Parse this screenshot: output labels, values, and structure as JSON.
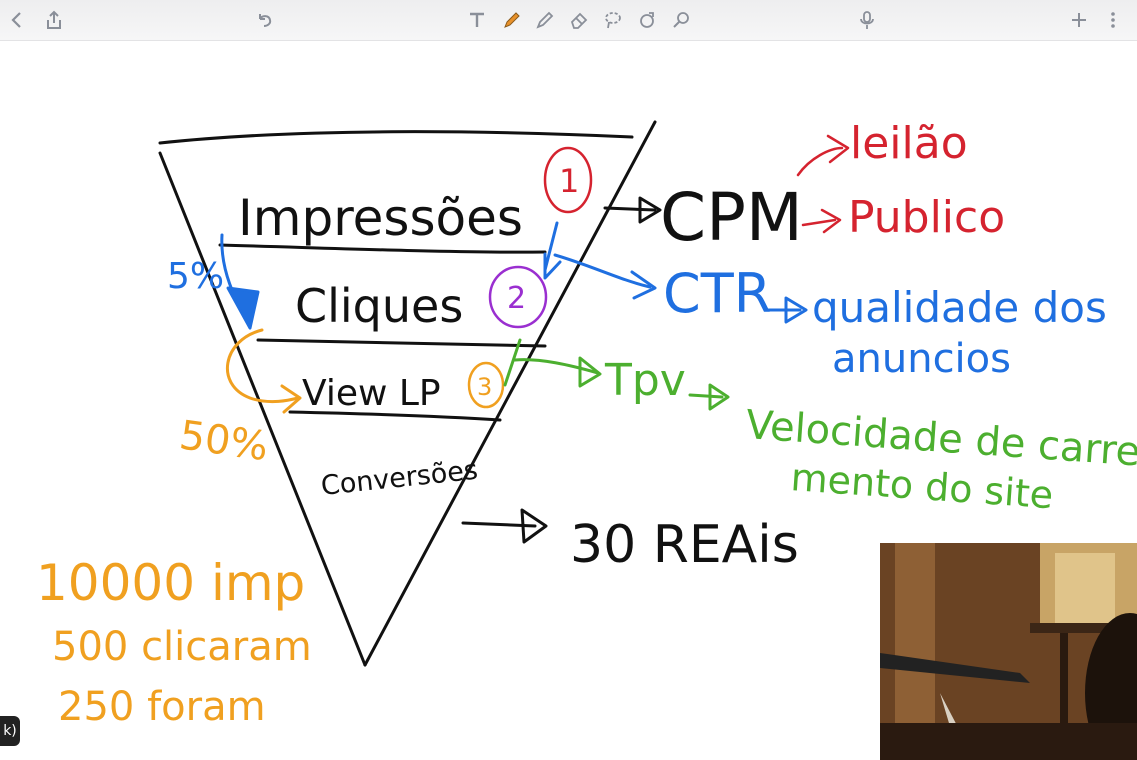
{
  "badge_text": "k)",
  "colors": {
    "black": "#111111",
    "red": "#d5232f",
    "blue": "#1f6fe0",
    "purple": "#9a2fd0",
    "green": "#4caf2f",
    "orange": "#f0a020",
    "toolbar_icon": "#8a8f99"
  },
  "toolbar": {
    "icons": [
      "back-icon",
      "share-icon",
      "undo-icon",
      "text-tool-icon",
      "pen-tool-icon",
      "highlighter-tool-icon",
      "eraser-tool-icon",
      "lasso-tool-icon",
      "shapes-tool-icon",
      "image-tool-icon",
      "microphone-icon",
      "add-page-icon",
      "more-icon"
    ]
  },
  "funnel": {
    "stages": [
      "Impressões",
      "Cliques",
      "View LP",
      "Conversões"
    ],
    "markers": [
      "1",
      "2",
      "3"
    ]
  },
  "metrics": {
    "cpm": "CPM",
    "ctr": "CTR",
    "tpv": "Tpv",
    "cost": "30 REAis"
  },
  "notes": {
    "leilao": "leilão",
    "publico": "Publico",
    "qualidade_1": "qualidade dos",
    "qualidade_2": "anuncios",
    "velocidade_1": "Velocidade de carrega-",
    "velocidade_2": "mento do site",
    "pct_5": "5%",
    "pct_50": "50%"
  },
  "stats": {
    "line1": "10000 imp",
    "line2": "500 clicaram",
    "line3": "250 foram"
  }
}
